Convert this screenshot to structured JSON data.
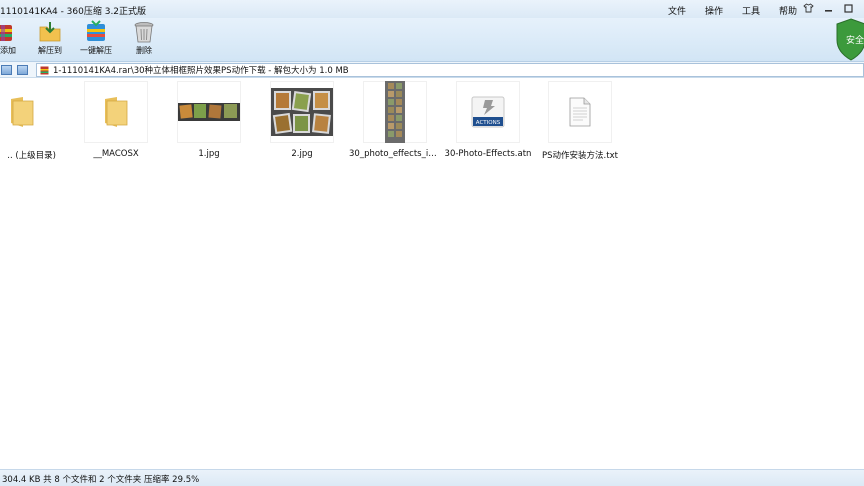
{
  "window": {
    "title": "1110141KA4 - 360压缩 3.2正式版"
  },
  "menu": {
    "items": [
      "文件",
      "操作",
      "工具",
      "帮助"
    ]
  },
  "toolbar": {
    "buttons": [
      {
        "label": "添加",
        "icon": "add-archive-icon"
      },
      {
        "label": "解压到",
        "icon": "extract-to-icon"
      },
      {
        "label": "一键解压",
        "icon": "one-click-extract-icon"
      },
      {
        "label": "删除",
        "icon": "trash-icon"
      }
    ],
    "badge": "安全"
  },
  "address": {
    "path": "1-1110141KA4.rar\\30种立体相框照片效果PS动作下载 - 解包大小为 1.0 MB"
  },
  "files": [
    {
      "name": ".. (上级目录)",
      "icon": "folder-icon"
    },
    {
      "name": "__MACOSX",
      "icon": "folder-icon"
    },
    {
      "name": "1.jpg",
      "icon": "image-thumbnail"
    },
    {
      "name": "2.jpg",
      "icon": "image-thumbnail"
    },
    {
      "name": "30_photo_effects_ind...",
      "icon": "image-thumbnail"
    },
    {
      "name": "30-Photo-Effects.atn",
      "icon": "actions-file-icon"
    },
    {
      "name": "PS动作安装方法.txt",
      "icon": "text-file-icon"
    }
  ],
  "actions_icon_label": "ACTIONS",
  "status": {
    "text": "304.4 KB 共 8 个文件和 2 个文件夹 压缩率 29.5%"
  },
  "colors": {
    "toolbar_bg": "#d2e5f5",
    "shield": "#3c9a3c",
    "folder": "#f3d27a"
  }
}
